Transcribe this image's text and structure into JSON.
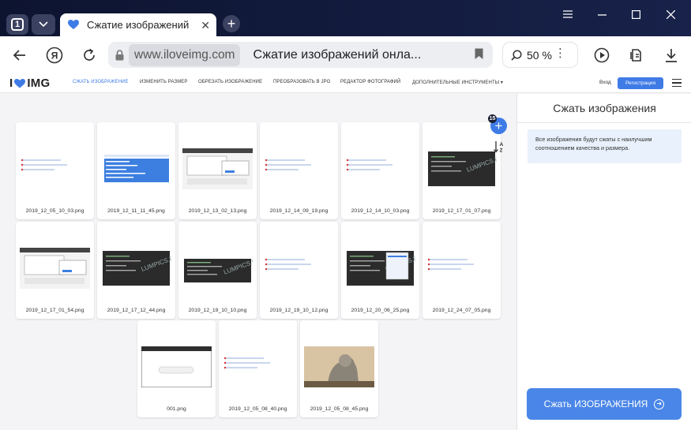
{
  "browser": {
    "tab_count": "1",
    "tab_title": "Сжатие изображений",
    "domain": "www.iloveimg.com",
    "page_title": "Сжатие изображений онла...",
    "zoom": "50 %"
  },
  "site": {
    "logo_left": "I",
    "logo_right": "IMG",
    "nav": [
      "Сжать изображение",
      "Изменить размер",
      "Обрезать изображение",
      "Преобразовать в JPG",
      "Редактор фотографий",
      "Дополнительные инструменты ▾"
    ],
    "login": "Вход",
    "register": "Регистрация"
  },
  "files": [
    {
      "name": "2019_12_05_10_03.png",
      "thumb": "white-red"
    },
    {
      "name": "2019_12_11_11_45.png",
      "thumb": "blue-table"
    },
    {
      "name": "2019_12_13_02_13.png",
      "thumb": "dialog"
    },
    {
      "name": "2019_12_14_09_19.png",
      "thumb": "white-red"
    },
    {
      "name": "2019_12_14_10_03.png",
      "thumb": "white-red"
    },
    {
      "name": "2019_12_17_01_07.png",
      "thumb": "dark"
    },
    {
      "name": "2019_12_17_01_54.png",
      "thumb": "dialog"
    },
    {
      "name": "2019_12_17_12_44.png",
      "thumb": "dark"
    },
    {
      "name": "2019_12_19_10_10.png",
      "thumb": "dark-small"
    },
    {
      "name": "2019_12_19_10_12.png",
      "thumb": "white-red"
    },
    {
      "name": "2019_12_20_06_25.png",
      "thumb": "dark-menu"
    },
    {
      "name": "2019_12_24_07_05.png",
      "thumb": "white-red"
    },
    {
      "name": "001.png",
      "thumb": "browser"
    },
    {
      "name": "2019_12_05_08_40.png",
      "thumb": "white-red"
    },
    {
      "name": "2019_12_05_08_45.png",
      "thumb": "statue"
    }
  ],
  "panel": {
    "title": "Сжать изображения",
    "note": "Все изображения будут сжаты с наилучшим соотношением качества и размера.",
    "button": "Сжать ИЗОБРАЖЕНИЯ"
  },
  "add_badge": "15",
  "colors": {
    "accent": "#3f7be6",
    "button": "#4a86e8",
    "note_bg": "#e8f1fc",
    "brand_heart": "#3f7be6"
  }
}
